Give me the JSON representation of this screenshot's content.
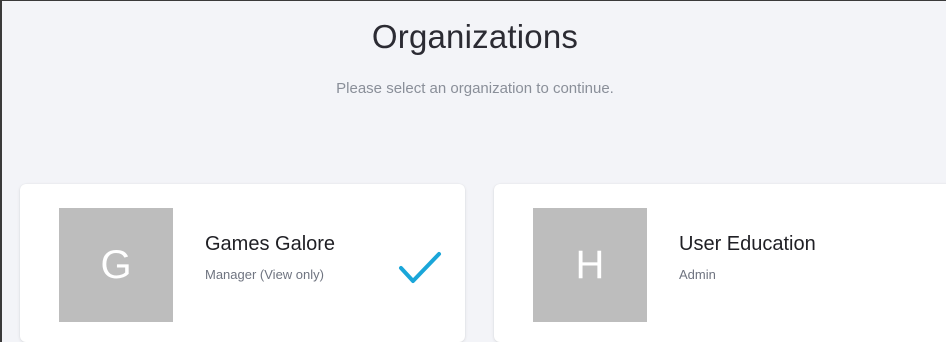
{
  "header": {
    "title": "Organizations",
    "subtitle": "Please select an organization to continue."
  },
  "organizations": [
    {
      "initial": "G",
      "name": "Games Galore",
      "role": "Manager (View only)",
      "selected": true,
      "avatar_color": "#bdbdbd"
    },
    {
      "initial": "H",
      "name": "User Education",
      "role": "Admin",
      "selected": false,
      "avatar_color": "#bdbdbd"
    }
  ],
  "colors": {
    "background": "#f3f4f8",
    "card": "#ffffff",
    "check": "#1aa6d9",
    "title_text": "#2b2b33",
    "muted_text": "#8a8f99"
  },
  "icons": {
    "selected_indicator": "checkmark-icon"
  }
}
